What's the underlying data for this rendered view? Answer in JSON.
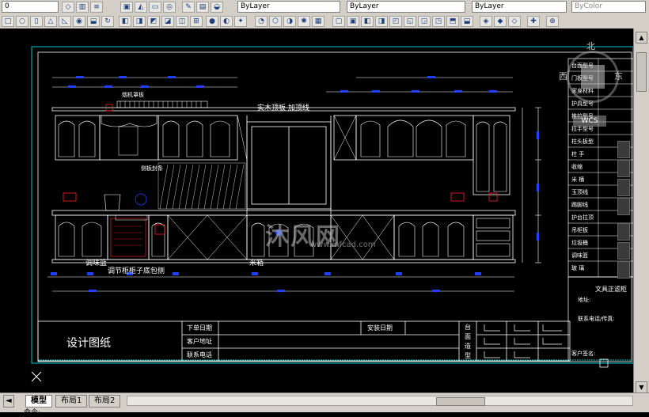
{
  "toolbar": {
    "layer_value": "0",
    "color_value": "ByLayer",
    "linetype_value": "ByLayer",
    "lineweight_value": "ByLayer",
    "plotstyle_value": "ByColor"
  },
  "drawing": {
    "title_block": "设计图纸",
    "order_date": "下单日期",
    "customer_address": "客户地址",
    "contact_phone": "联系电话",
    "install_date": "安装日期",
    "countertop_shape_1": "台",
    "countertop_shape_2": "面",
    "countertop_shape_3": "造",
    "countertop_shape_4": "型",
    "ceiling_label": "实木顶板 加顶线",
    "grab_label": "调味篮",
    "left_tail": "调节柜柜子底包侧",
    "bottom_mid": "米箱",
    "customer_signature": "客户签名:",
    "dealer": "文具正滤柜",
    "address_label": "地址:",
    "phone_label": "联系电话/传真:",
    "hood_label": "烟机罩板",
    "under_label": "侧板封条"
  },
  "spec_table": {
    "rows": [
      "台面型号",
      "门板型号",
      "家身材料",
      "护具型号",
      "推拉型号",
      "拉手型号",
      "柱头板型",
      "柱  手",
      "收缩",
      "米  桶",
      "玉顶线",
      "踢脚线",
      "护台拉顶",
      "吊柜板",
      "垃圾桶",
      "调味篮",
      "玻  璃"
    ]
  },
  "compass": {
    "north": "北",
    "west": "西",
    "east": "东",
    "wcs": "WCS"
  },
  "watermark": {
    "title": "沐风网",
    "url": "www.mfcad.com"
  },
  "tabs": [
    "模型",
    "布局1",
    "布局2"
  ],
  "command_line": "命令:",
  "colors": {
    "cad_cyan": "#00c8c8",
    "cad_red": "#ff2020",
    "cad_blue": "#2040ff",
    "cad_white": "#ffffff",
    "toolbar_bg": "#d4d0c8"
  }
}
